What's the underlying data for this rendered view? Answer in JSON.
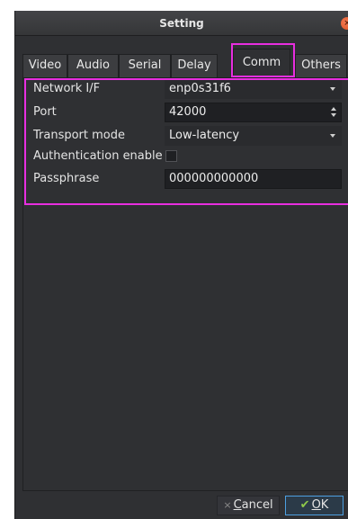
{
  "window": {
    "title": "Setting",
    "close_glyph": "×"
  },
  "tabs": [
    {
      "label": "Video"
    },
    {
      "label": "Audio"
    },
    {
      "label": "Serial"
    },
    {
      "label": "Delay"
    },
    {
      "label": "Comm",
      "active": true
    },
    {
      "label": "Others"
    }
  ],
  "form": {
    "network_if": {
      "label": "Network I/F",
      "value": "enp0s31f6"
    },
    "port": {
      "label": "Port",
      "value": "42000"
    },
    "transport_mode": {
      "label": "Transport mode",
      "value": "Low-latency"
    },
    "authentication": {
      "label": "Authentication enable",
      "checked": false
    },
    "passphrase": {
      "label": "Passphrase",
      "value": "000000000000"
    }
  },
  "buttons": {
    "cancel_icon": "×",
    "cancel_mnemonic": "C",
    "cancel_rest": "ancel",
    "ok_icon": "✔",
    "ok_mnemonic": "O",
    "ok_rest": "K"
  },
  "colors": {
    "highlight": "#e82ee0",
    "window_bg": "#2f3033",
    "ok_border": "#4d9fe0"
  }
}
